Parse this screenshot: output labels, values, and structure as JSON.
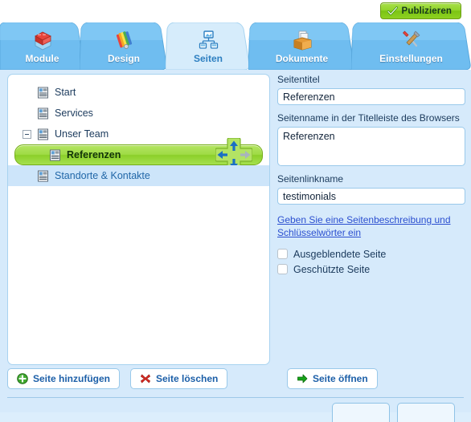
{
  "topbar": {
    "publish_label": "Publizieren",
    "publish_icon": "check-icon"
  },
  "tabs": [
    {
      "label": "Module",
      "icon": "blocks-icon",
      "active": false
    },
    {
      "label": "Design",
      "icon": "palette-icon",
      "active": false
    },
    {
      "label": "Seiten",
      "icon": "sitemap-icon",
      "active": true
    },
    {
      "label": "Dokumente",
      "icon": "box-icon",
      "active": false
    },
    {
      "label": "Einstellungen",
      "icon": "tools-icon",
      "active": false
    }
  ],
  "tree": {
    "nodes": [
      {
        "label": "Start",
        "icon": "page-icon",
        "indent": 0,
        "twisty": "none",
        "state": "normal"
      },
      {
        "label": "Services",
        "icon": "page-icon",
        "indent": 0,
        "twisty": "none",
        "state": "normal"
      },
      {
        "label": "Unser Team",
        "icon": "page-icon",
        "indent": 0,
        "twisty": "collapse",
        "state": "normal"
      },
      {
        "label": "Referenzen",
        "icon": "page-icon",
        "indent": 1,
        "twisty": "none",
        "state": "selected"
      },
      {
        "label": "Standorte & Kontakte",
        "icon": "page-icon",
        "indent": 0,
        "twisty": "none",
        "state": "hovered"
      }
    ],
    "drag_widget": {
      "name": "move-node-widget",
      "up": "enabled",
      "down": "enabled",
      "left": "enabled",
      "right": "disabled"
    }
  },
  "actions": [
    {
      "label": "Seite hinzufügen",
      "icon": "plus-circle-icon"
    },
    {
      "label": "Seite löschen",
      "icon": "red-x-icon"
    },
    {
      "label": "Seite öffnen",
      "icon": "green-arrow-icon"
    }
  ],
  "form": {
    "title_label": "Seitentitel",
    "title_value": "Referenzen",
    "browser_label": "Seitenname in der Titelleiste des Browsers",
    "browser_value": "Referenzen",
    "linkname_label": "Seitenlinkname",
    "linkname_value": "testimonials",
    "description_link": "Geben Sie eine Seitenbeschreibung und Schlüsselwörter ein",
    "checkboxes": [
      {
        "label": "Ausgeblendete Seite",
        "checked": false
      },
      {
        "label": "Geschützte Seite",
        "checked": false
      }
    ]
  },
  "colors": {
    "accent_blue": "#2d7fc1",
    "tab_blue": "#6fbdf0",
    "active_tab": "#d6ecfb",
    "panel_bg": "#d6eafb",
    "select_green": "#9fdb45",
    "publish_green": "#93d52c",
    "link_blue": "#2b4fd0"
  }
}
